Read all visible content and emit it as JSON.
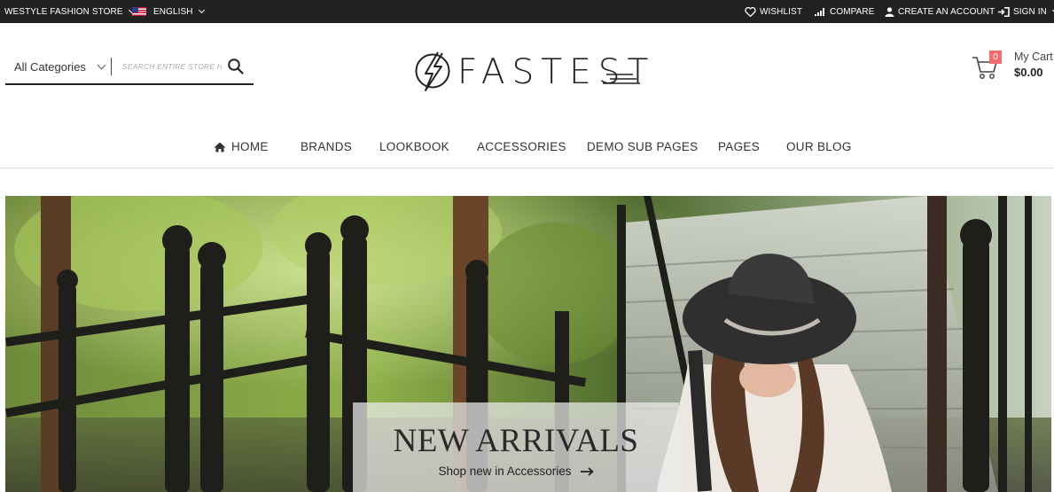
{
  "topbar": {
    "store_switcher": "WESTYLE FASHION STORE",
    "language": "ENGLISH",
    "wishlist": "WISHLIST",
    "compare": "COMPARE",
    "create_account": "CREATE AN ACCOUNT",
    "sign_in": "SIGN IN"
  },
  "search": {
    "category": "All Categories",
    "placeholder": "SEARCH ENTIRE STORE H"
  },
  "logo": {
    "text": "FASTEST"
  },
  "cart": {
    "count": "0",
    "label": "My Cart",
    "total": "$0.00"
  },
  "nav": {
    "items": [
      {
        "label": "HOME",
        "icon": "home-icon"
      },
      {
        "label": "BRANDS"
      },
      {
        "label": "LOOKBOOK"
      },
      {
        "label": "ACCESSORIES"
      },
      {
        "label": "DEMO SUB PAGES"
      },
      {
        "label": "PAGES"
      },
      {
        "label": "OUR BLOG"
      }
    ]
  },
  "hero": {
    "title": "NEW ARRIVALS",
    "link": "Shop new in Accessories"
  },
  "colors": {
    "topbar_bg": "#222222",
    "cart_badge": "#f36b6b",
    "text_dark": "#222222"
  }
}
